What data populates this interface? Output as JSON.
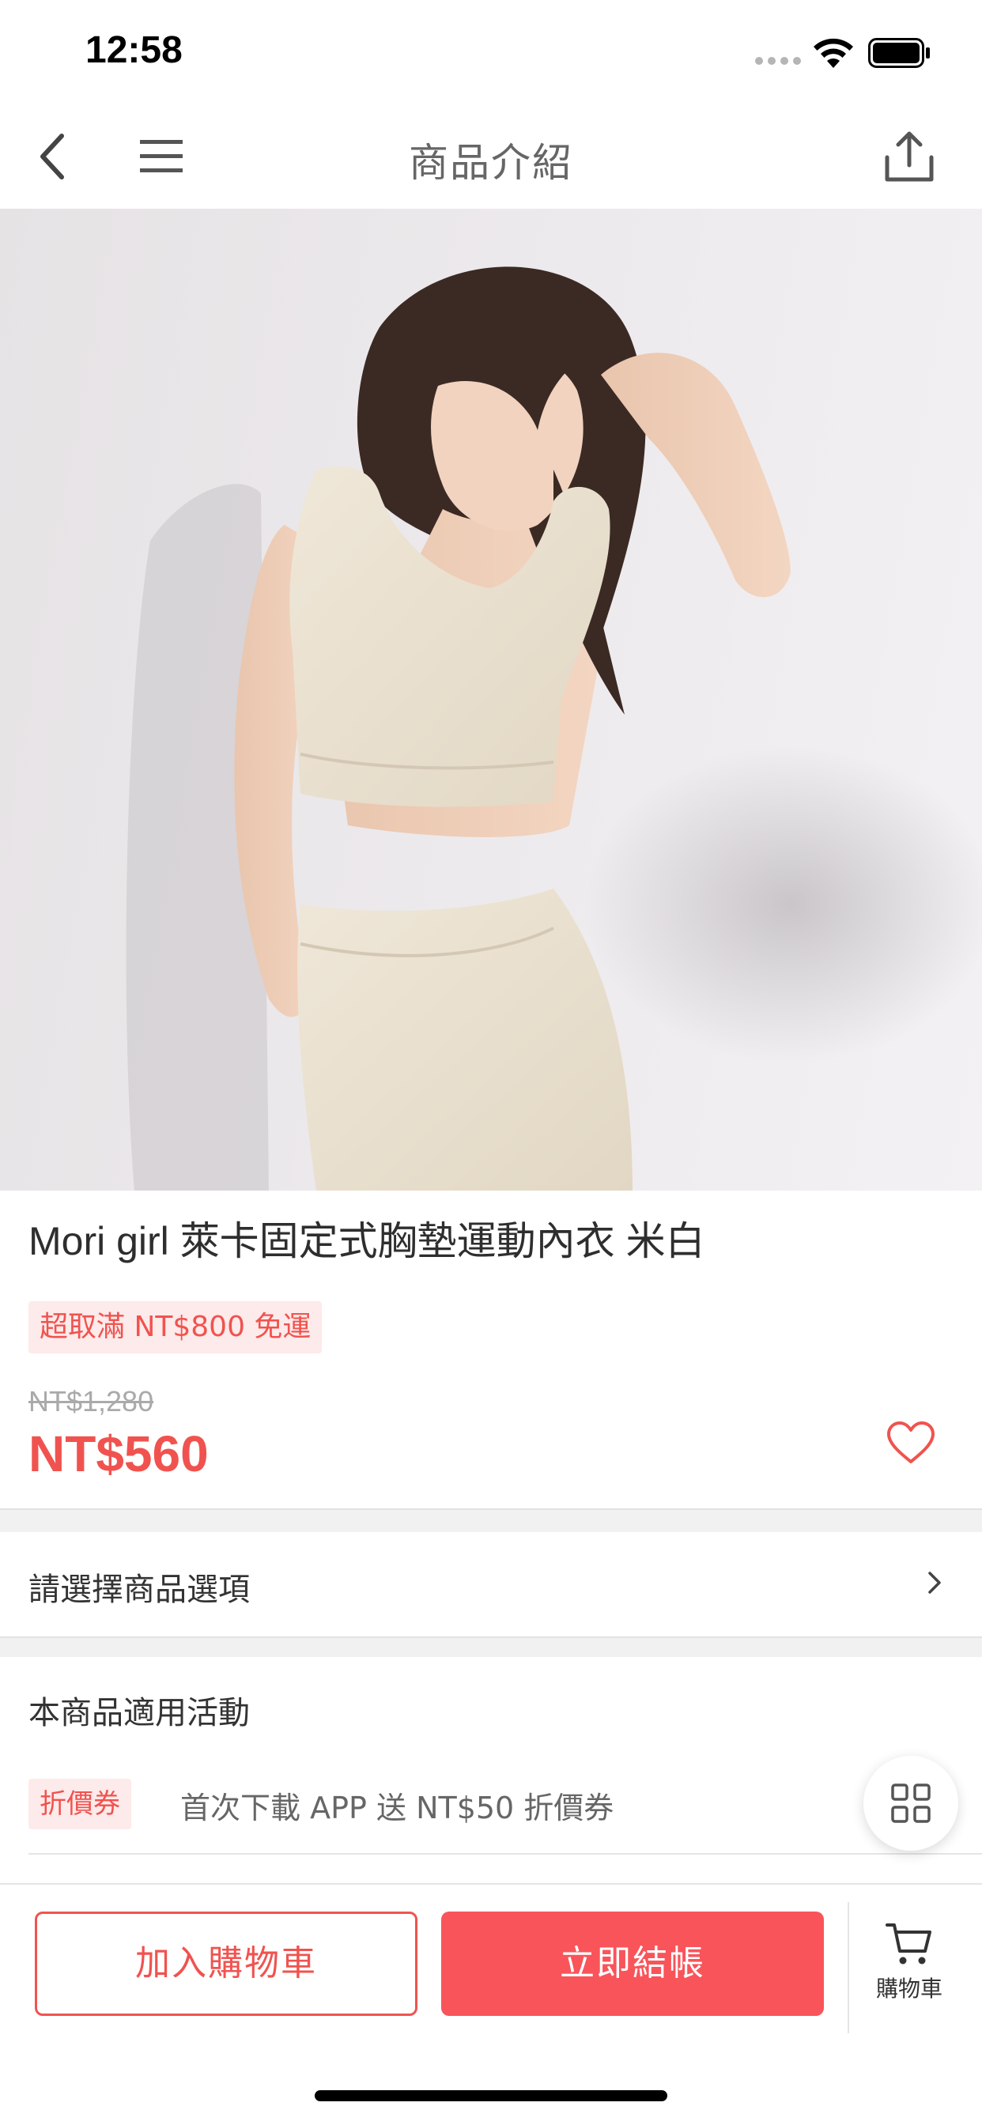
{
  "status_bar": {
    "time": "12:58"
  },
  "nav": {
    "title": "商品介紹"
  },
  "product": {
    "title": "Mori girl 萊卡固定式胸墊運動內衣 米白",
    "shipping_badge": "超取滿 NT$800 免運",
    "original_price": "NT$1,280",
    "sale_price": "NT$560"
  },
  "options": {
    "label": "請選擇商品選項"
  },
  "promotions": {
    "section_title": "本商品適用活動",
    "items": [
      {
        "tag": "折價券",
        "text": "首次下載 APP 送 NT$50 折價券"
      }
    ]
  },
  "bottom_bar": {
    "add_to_cart": "加入購物車",
    "checkout": "立即結帳",
    "cart_label": "購物車"
  },
  "colors": {
    "accent": "#f0534f",
    "checkout_bg": "#f9545a",
    "badge_bg": "#fdeaea",
    "divider": "#f1f1f1"
  },
  "icons": [
    "back-icon",
    "menu-icon",
    "share-icon",
    "heart-icon",
    "chevron-right-icon",
    "grid-icon",
    "cart-icon",
    "wifi-icon",
    "battery-icon"
  ]
}
